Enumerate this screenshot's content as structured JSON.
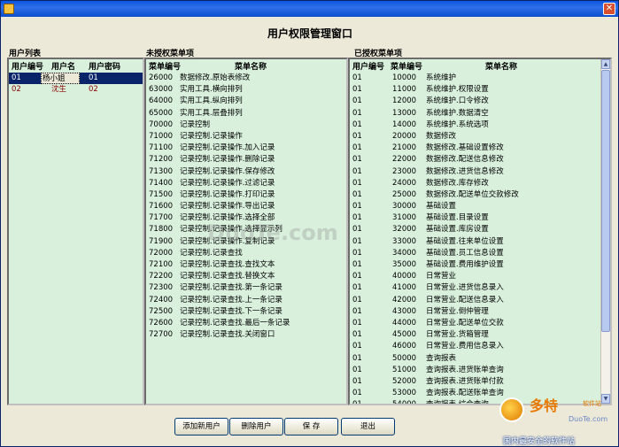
{
  "window": {
    "title": "",
    "close_glyph": "✕"
  },
  "header": {
    "title": "用户权限管理窗口"
  },
  "users": {
    "label": "用户列表",
    "columns": [
      "用户编号",
      "用户名",
      "用户密码"
    ],
    "rows": [
      [
        "01",
        "杨小姐",
        "01"
      ],
      [
        "02",
        "沈生",
        "02"
      ]
    ]
  },
  "unauthorized": {
    "label": "未授权菜单项",
    "columns": [
      "菜单编号",
      "菜单名称"
    ],
    "rows": [
      [
        "26000",
        "数据修改.原始表修改"
      ],
      [
        "63000",
        "实用工具.横向排列"
      ],
      [
        "64000",
        "实用工具.纵向排列"
      ],
      [
        "65000",
        "实用工具.层叠排列"
      ],
      [
        "70000",
        "记录控制"
      ],
      [
        "71000",
        "记录控制.记录操作"
      ],
      [
        "71100",
        "记录控制.记录操作.加入记录"
      ],
      [
        "71200",
        "记录控制.记录操作.删除记录"
      ],
      [
        "71300",
        "记录控制.记录操作.保存修改"
      ],
      [
        "71400",
        "记录控制.记录操作.过滤记录"
      ],
      [
        "71500",
        "记录控制.记录操作.打印记录"
      ],
      [
        "71600",
        "记录控制.记录操作.导出记录"
      ],
      [
        "71700",
        "记录控制.记录操作.选择全部"
      ],
      [
        "71800",
        "记录控制.记录操作.选择显示列"
      ],
      [
        "71900",
        "记录控制.记录操作.复制记录"
      ],
      [
        "72000",
        "记录控制.记录查找"
      ],
      [
        "72100",
        "记录控制.记录查找.查找文本"
      ],
      [
        "72200",
        "记录控制.记录查找.替换文本"
      ],
      [
        "72300",
        "记录控制.记录查找.第一条记录"
      ],
      [
        "72400",
        "记录控制.记录查找.上一条记录"
      ],
      [
        "72500",
        "记录控制.记录查找.下一条记录"
      ],
      [
        "72600",
        "记录控制.记录查找.最后一条记录"
      ],
      [
        "72700",
        "记录控制.记录查找.关闭窗口"
      ]
    ]
  },
  "authorized": {
    "label": "已授权菜单项",
    "columns": [
      "用户编号",
      "菜单编号",
      "菜单名称"
    ],
    "rows": [
      [
        "01",
        "10000",
        "系统维护"
      ],
      [
        "01",
        "11000",
        "系统维护.权限设置"
      ],
      [
        "01",
        "12000",
        "系统维护.口令修改"
      ],
      [
        "01",
        "13000",
        "系统维护.数据清空"
      ],
      [
        "01",
        "14000",
        "系统维护.系统选项"
      ],
      [
        "01",
        "20000",
        "数据修改"
      ],
      [
        "01",
        "21000",
        "数据修改.基础设置修改"
      ],
      [
        "01",
        "22000",
        "数据修改.配送信息修改"
      ],
      [
        "01",
        "23000",
        "数据修改.进货信息修改"
      ],
      [
        "01",
        "24000",
        "数据修改.库存修改"
      ],
      [
        "01",
        "25000",
        "数据修改.配送单位交款修改"
      ],
      [
        "01",
        "30000",
        "基础设置"
      ],
      [
        "01",
        "31000",
        "基础设置.目录设置"
      ],
      [
        "01",
        "32000",
        "基础设置.库房设置"
      ],
      [
        "01",
        "33000",
        "基础设置.往来单位设置"
      ],
      [
        "01",
        "34000",
        "基础设置.员工信息设置"
      ],
      [
        "01",
        "35000",
        "基础设置.费用维护设置"
      ],
      [
        "01",
        "40000",
        "日常营业"
      ],
      [
        "01",
        "41000",
        "日常营业.进货信息录入"
      ],
      [
        "01",
        "42000",
        "日常营业.配送信息录入"
      ],
      [
        "01",
        "43000",
        "日常营业.倒仲管理"
      ],
      [
        "01",
        "44000",
        "日常营业.配送单位交款"
      ],
      [
        "01",
        "45000",
        "日常营业.货箱管理"
      ],
      [
        "01",
        "46000",
        "日常营业.费用信息录入"
      ],
      [
        "01",
        "50000",
        "查询报表"
      ],
      [
        "01",
        "51000",
        "查询报表.进货账单查询"
      ],
      [
        "01",
        "52000",
        "查询报表.进货账单付款"
      ],
      [
        "01",
        "53000",
        "查询报表.配送账单查询"
      ],
      [
        "01",
        "54000",
        "查询报表.综合查询"
      ]
    ]
  },
  "buttons": {
    "add_user": "添加新用户",
    "delete_user": "删除用户",
    "save": "保 存",
    "exit": "退出"
  },
  "scroll": {
    "up_glyph": "▲",
    "down_glyph": "▼"
  },
  "watermark": "DuoTe.com",
  "logo": {
    "name": "多特",
    "tagline": "软件站",
    "url": "DuoTe.com",
    "slogan": "国内最安全的软件站"
  }
}
